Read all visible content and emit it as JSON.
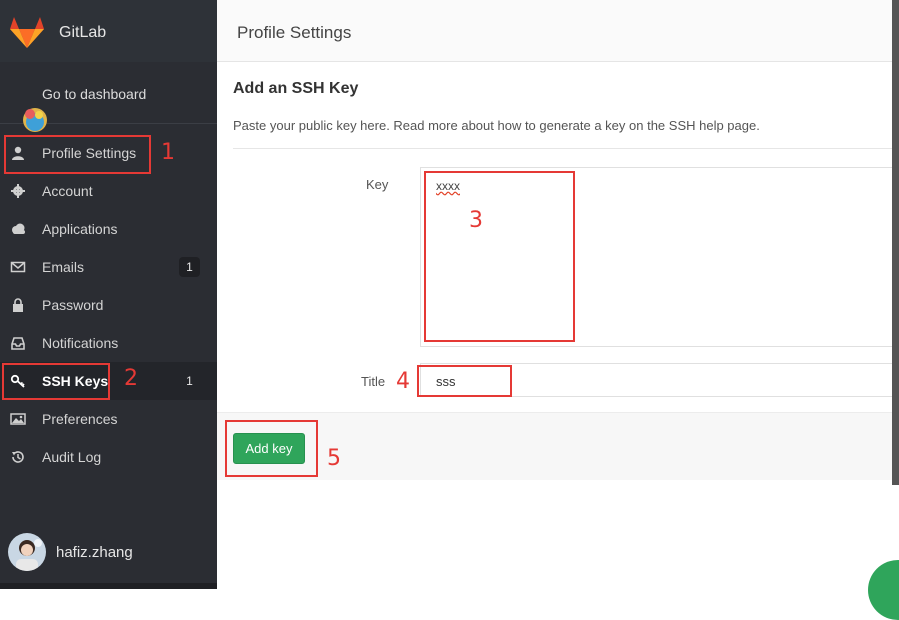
{
  "brand": {
    "name": "GitLab",
    "logo_icon": "gitlab-fox-icon"
  },
  "sidebar": {
    "dashboard_label": "Go to dashboard",
    "items": [
      {
        "label": "Profile Settings",
        "icon": "user-icon",
        "badge": ""
      },
      {
        "label": "Account",
        "icon": "gear-icon",
        "badge": ""
      },
      {
        "label": "Applications",
        "icon": "cloud-icon",
        "badge": ""
      },
      {
        "label": "Emails",
        "icon": "envelope-icon",
        "badge": "1"
      },
      {
        "label": "Password",
        "icon": "lock-icon",
        "badge": ""
      },
      {
        "label": "Notifications",
        "icon": "inbox-icon",
        "badge": ""
      },
      {
        "label": "SSH Keys",
        "icon": "key-icon",
        "badge": "1"
      },
      {
        "label": "Preferences",
        "icon": "image-icon",
        "badge": ""
      },
      {
        "label": "Audit Log",
        "icon": "history-icon",
        "badge": ""
      }
    ],
    "active_index": 6,
    "user": {
      "name": "hafiz.zhang"
    }
  },
  "header": {
    "title": "Profile Settings"
  },
  "main": {
    "section_title": "Add an SSH Key",
    "hint": "Paste your public key here. Read more about how to generate a key on the SSH help page.",
    "key_label": "Key",
    "key_value": "xxxx",
    "title_label": "Title",
    "title_value": "sss",
    "add_button": "Add key"
  },
  "annotations": [
    "1",
    "2",
    "3",
    "4",
    "5"
  ],
  "colors": {
    "sidebar_bg": "#2b2d33",
    "accent_green": "#2fa55b",
    "annotation_red": "#e53935"
  }
}
